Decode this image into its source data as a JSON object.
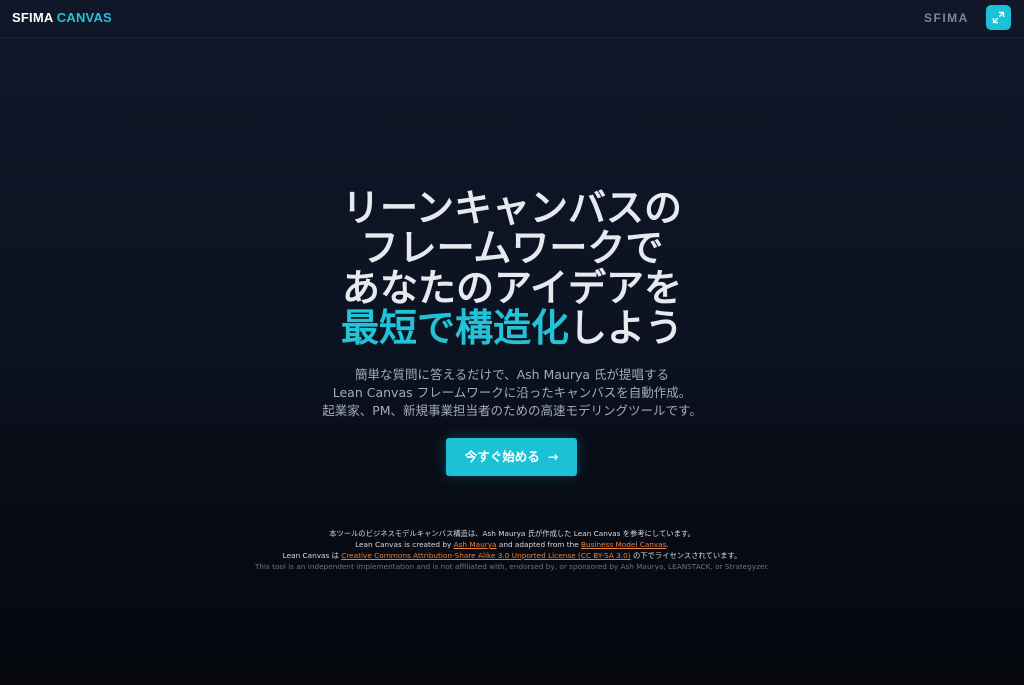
{
  "header": {
    "logo_primary": "SFIMA",
    "logo_accent": "CANVAS",
    "brand_right": "SFIMA",
    "expand_icon": "expand-icon"
  },
  "hero": {
    "headline": [
      "リーンキャンバスの",
      "フレームワークで",
      "あなたのアイデアを"
    ],
    "headline_accent": "最短で構造化",
    "headline_tail": "しよう",
    "subtitle": [
      "簡単な質問に答えるだけで、Ash Maurya 氏が提唱する",
      "Lean Canvas フレームワークに沿ったキャンバスを自動作成。",
      "起業家、PM、新規事業担当者のための高速モデリングツールです。"
    ],
    "cta_label": "今すぐ始める",
    "cta_icon": "arrow-right-icon"
  },
  "footer": {
    "line1": "本ツールのビジネスモデルキャンバス構造は、Ash Maurya 氏が作成した Lean Canvas を参考にしています。",
    "line2_pre": "Lean Canvas is created by ",
    "line2_link1": "Ash Maurya",
    "line2_mid": " and adapted from the ",
    "line2_link2": "Business Model Canvas",
    "line2_post": ".",
    "line3_pre": "Lean Canvas は ",
    "line3_link": "Creative Commons Attribution-Share Alike 3.0 Unported License (CC BY-SA 3.0)",
    "line3_post": " の下でライセンスされています。",
    "line4": "This tool is an independent implementation and is not affiliated with, endorsed by, or sponsored by Ash Maurya, LEANSTACK, or Strategyzer."
  },
  "colors": {
    "accent": "#22c3d6",
    "button": "#1bc1d4",
    "link": "#e8803a",
    "background": "#0c1322"
  }
}
